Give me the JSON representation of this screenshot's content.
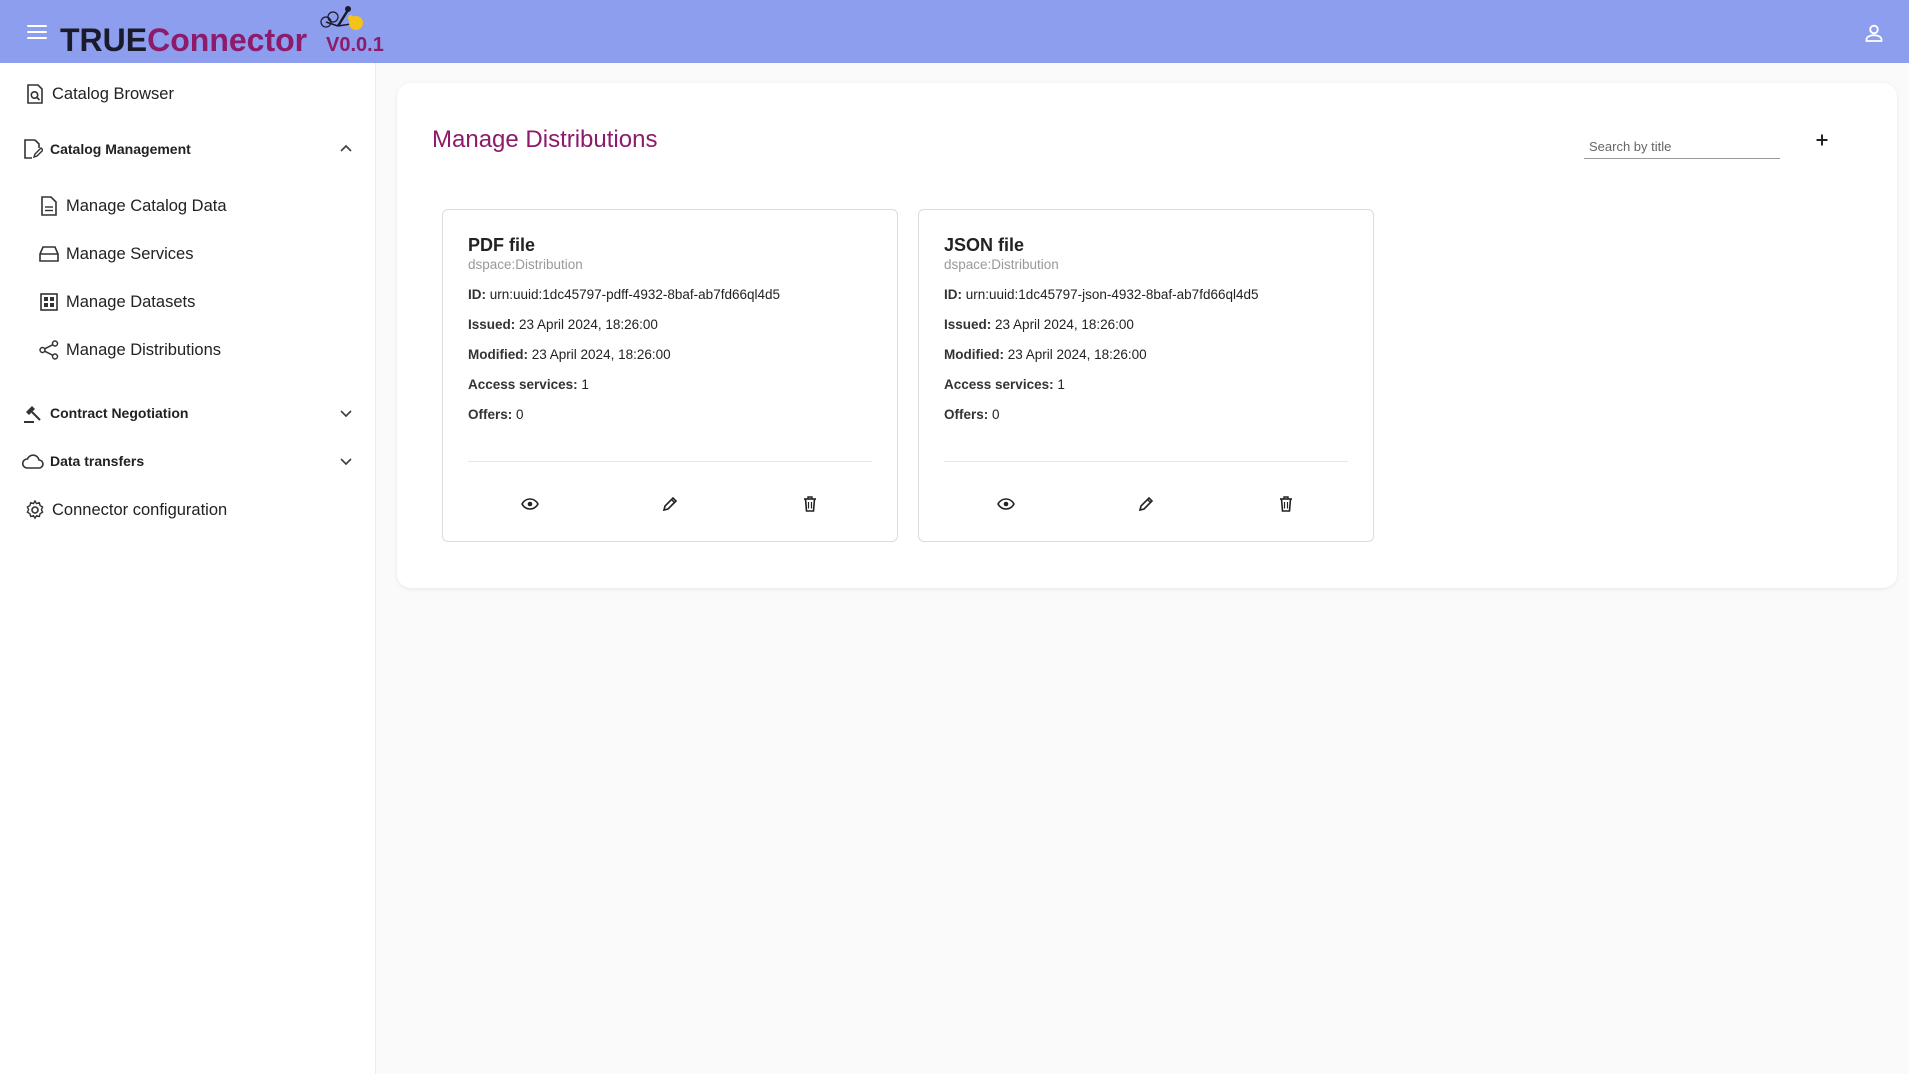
{
  "app": {
    "logo_true": "TRUE",
    "logo_connector": "Connector",
    "version": "V0.0.1"
  },
  "sidebar": {
    "catalog_browser": "Catalog Browser",
    "catalog_management": "Catalog Management",
    "manage_catalog_data": "Manage Catalog Data",
    "manage_services": "Manage Services",
    "manage_datasets": "Manage Datasets",
    "manage_distributions": "Manage Distributions",
    "contract_negotiation": "Contract Negotiation",
    "data_transfers": "Data transfers",
    "connector_configuration": "Connector configuration"
  },
  "main": {
    "title": "Manage Distributions",
    "search_placeholder": "Search by title",
    "add_symbol": "+",
    "cards": [
      {
        "title": "PDF file",
        "type": "dspace:Distribution",
        "id_label": "ID:",
        "id_value": "urn:uuid:1dc45797-pdff-4932-8baf-ab7fd66ql4d5",
        "issued_label": "Issued:",
        "issued_value": "23 April 2024, 18:26:00",
        "modified_label": "Modified:",
        "modified_value": "23 April 2024, 18:26:00",
        "access_label": "Access services:",
        "access_value": "1",
        "offers_label": "Offers:",
        "offers_value": "0"
      },
      {
        "title": "JSON file",
        "type": "dspace:Distribution",
        "id_label": "ID:",
        "id_value": "urn:uuid:1dc45797-json-4932-8baf-ab7fd66ql4d5",
        "issued_label": "Issued:",
        "issued_value": "23 April 2024, 18:26:00",
        "modified_label": "Modified:",
        "modified_value": "23 April 2024, 18:26:00",
        "access_label": "Access services:",
        "access_value": "1",
        "offers_label": "Offers:",
        "offers_value": "0"
      }
    ]
  },
  "colors": {
    "topbar": "#8c9eed",
    "accent": "#8e1a6b"
  }
}
